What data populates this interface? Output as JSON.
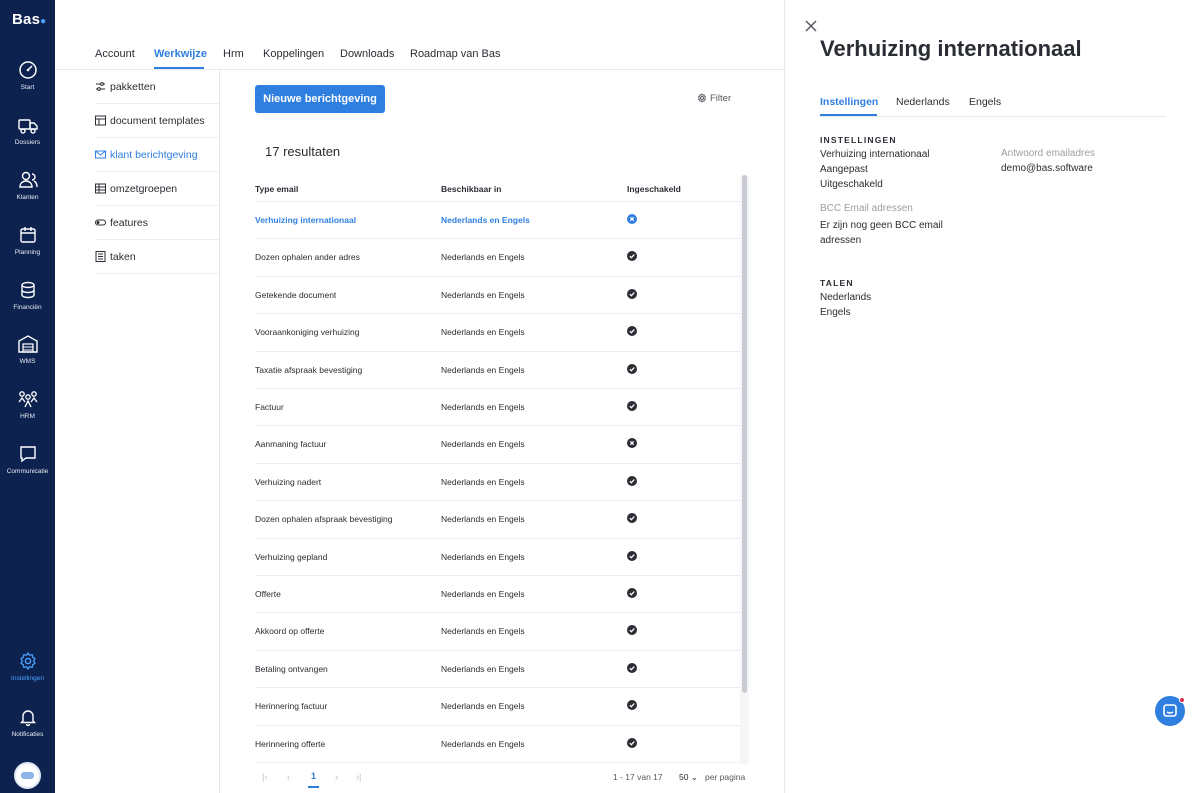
{
  "brand": "Bas",
  "rail": [
    {
      "label": "Start",
      "icon": "dashboard-icon"
    },
    {
      "label": "Dossiers",
      "icon": "truck-icon"
    },
    {
      "label": "Klanten",
      "icon": "users-icon"
    },
    {
      "label": "Planning",
      "icon": "calendar-icon"
    },
    {
      "label": "Financiën",
      "icon": "coins-icon"
    },
    {
      "label": "WMS",
      "icon": "warehouse-icon"
    },
    {
      "label": "HRM",
      "icon": "team-icon"
    },
    {
      "label": "Communicatie",
      "icon": "chat-icon"
    },
    {
      "label": "Instellingen",
      "icon": "gear-icon"
    },
    {
      "label": "Notificaties",
      "icon": "bell-icon"
    }
  ],
  "topnav": {
    "tabs": [
      "Account",
      "Werkwijze",
      "Hrm",
      "Koppelingen",
      "Downloads",
      "Roadmap van Bas"
    ],
    "active": "Werkwijze"
  },
  "subnav": [
    {
      "label": "pakketten",
      "icon": "sliders-icon"
    },
    {
      "label": "document templates",
      "icon": "template-icon"
    },
    {
      "label": "klant berichtgeving",
      "icon": "mail-icon"
    },
    {
      "label": "omzetgroepen",
      "icon": "table-icon"
    },
    {
      "label": "features",
      "icon": "toggle-icon"
    },
    {
      "label": "taken",
      "icon": "checklist-icon"
    }
  ],
  "main": {
    "new_button": "Nieuwe berichtgeving",
    "filter_label": "Filter",
    "results": "17 resultaten",
    "columns": [
      "Type email",
      "Beschikbaar in",
      "Ingeschakeld"
    ],
    "rows": [
      {
        "type": "Verhuizing internationaal",
        "available": "Nederlands en Engels",
        "enabled": false,
        "selected": true
      },
      {
        "type": "Dozen ophalen ander adres",
        "available": "Nederlands en Engels",
        "enabled": true
      },
      {
        "type": "Getekende document",
        "available": "Nederlands en Engels",
        "enabled": true
      },
      {
        "type": "Vooraankoniging verhuizing",
        "available": "Nederlands en Engels",
        "enabled": true
      },
      {
        "type": "Taxatie afspraak bevestiging",
        "available": "Nederlands en Engels",
        "enabled": true
      },
      {
        "type": "Factuur",
        "available": "Nederlands en Engels",
        "enabled": true
      },
      {
        "type": "Aanmaning factuur",
        "available": "Nederlands en Engels",
        "enabled": false
      },
      {
        "type": "Verhuizing nadert",
        "available": "Nederlands en Engels",
        "enabled": true
      },
      {
        "type": "Dozen ophalen afspraak bevestiging",
        "available": "Nederlands en Engels",
        "enabled": true
      },
      {
        "type": "Verhuizing gepland",
        "available": "Nederlands en Engels",
        "enabled": true
      },
      {
        "type": "Offerte",
        "available": "Nederlands en Engels",
        "enabled": true
      },
      {
        "type": "Akkoord op offerte",
        "available": "Nederlands en Engels",
        "enabled": true
      },
      {
        "type": "Betaling ontvangen",
        "available": "Nederlands en Engels",
        "enabled": true
      },
      {
        "type": "Herinnering factuur",
        "available": "Nederlands en Engels",
        "enabled": true
      },
      {
        "type": "Herinnering offerte",
        "available": "Nederlands en Engels",
        "enabled": true
      }
    ]
  },
  "pagination": {
    "current_page": "1",
    "range": "1 - 17 van 17",
    "per_page": "50",
    "per_page_label": "per pagina"
  },
  "panel": {
    "title": "Verhuizing internationaal",
    "tabs": [
      "Instellingen",
      "Nederlands",
      "Engels"
    ],
    "active_tab": "Instellingen",
    "settings_heading": "INSTELLINGEN",
    "name": "Verhuizing internationaal",
    "state": "Aangepast",
    "enabled_text": "Uitgeschakeld",
    "reply_label": "Antwoord emailadres",
    "reply_value": "demo@bas.software",
    "bcc_label": "BCC Email adressen",
    "bcc_value": "Er zijn nog geen BCC email adressen",
    "languages_heading": "TALEN",
    "languages": [
      "Nederlands",
      "Engels"
    ]
  },
  "colors": {
    "rail_bg": "#0e2250",
    "accent": "#2f7fe0",
    "text": "#2a2d33"
  }
}
